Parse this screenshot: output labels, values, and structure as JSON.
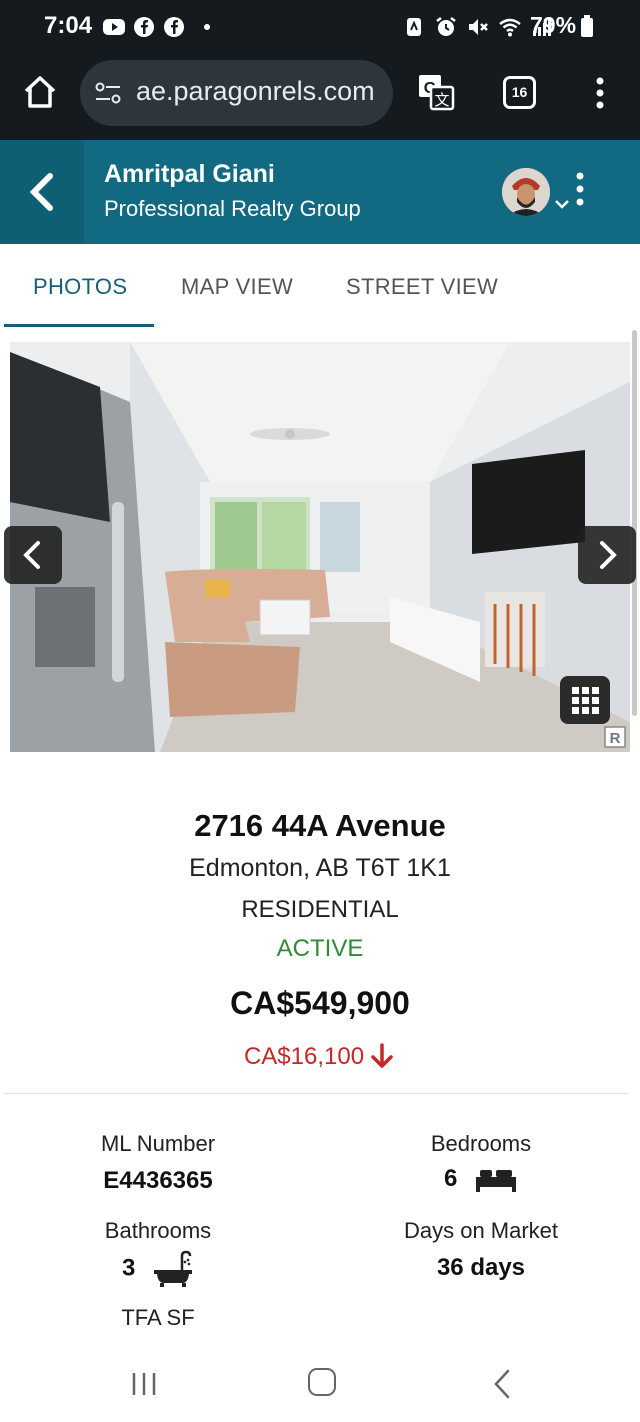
{
  "status_bar": {
    "time": "7:04",
    "battery": "79%",
    "left_icons": [
      "youtube-icon",
      "facebook-icon",
      "facebook-icon",
      "dot-icon"
    ],
    "right_icons": [
      "nfc-icon",
      "alarm-icon",
      "mute-icon",
      "wifi-icon",
      "signal-icon",
      "battery-icon"
    ]
  },
  "browser": {
    "url": "ae.paragonrels.com",
    "tab_count": "16"
  },
  "header": {
    "agent_name": "Amritpal Giani",
    "company": "Professional Realty Group"
  },
  "tabs": [
    {
      "label": "PHOTOS",
      "active": true
    },
    {
      "label": "MAP VIEW",
      "active": false
    },
    {
      "label": "STREET VIEW",
      "active": false
    }
  ],
  "listing": {
    "address": "2716 44A Avenue",
    "city_line": "Edmonton, AB T6T 1K1",
    "property_type": "RESIDENTIAL",
    "status": "ACTIVE",
    "price": "CA$549,900",
    "price_change": "CA$16,100"
  },
  "stats": {
    "ml_number_label": "ML Number",
    "ml_number_value": "E4436365",
    "bedrooms_label": "Bedrooms",
    "bedrooms_value": "6",
    "bathrooms_label": "Bathrooms",
    "bathrooms_value": "3",
    "days_label": "Days on Market",
    "days_value": "36 days",
    "tfa_label": "TFA SF"
  },
  "colors": {
    "header_bg": "#116a82",
    "tab_active": "#17607a",
    "status_active": "#2f8a3a",
    "price_drop": "#c62828",
    "system_bar": "#141a1e"
  }
}
